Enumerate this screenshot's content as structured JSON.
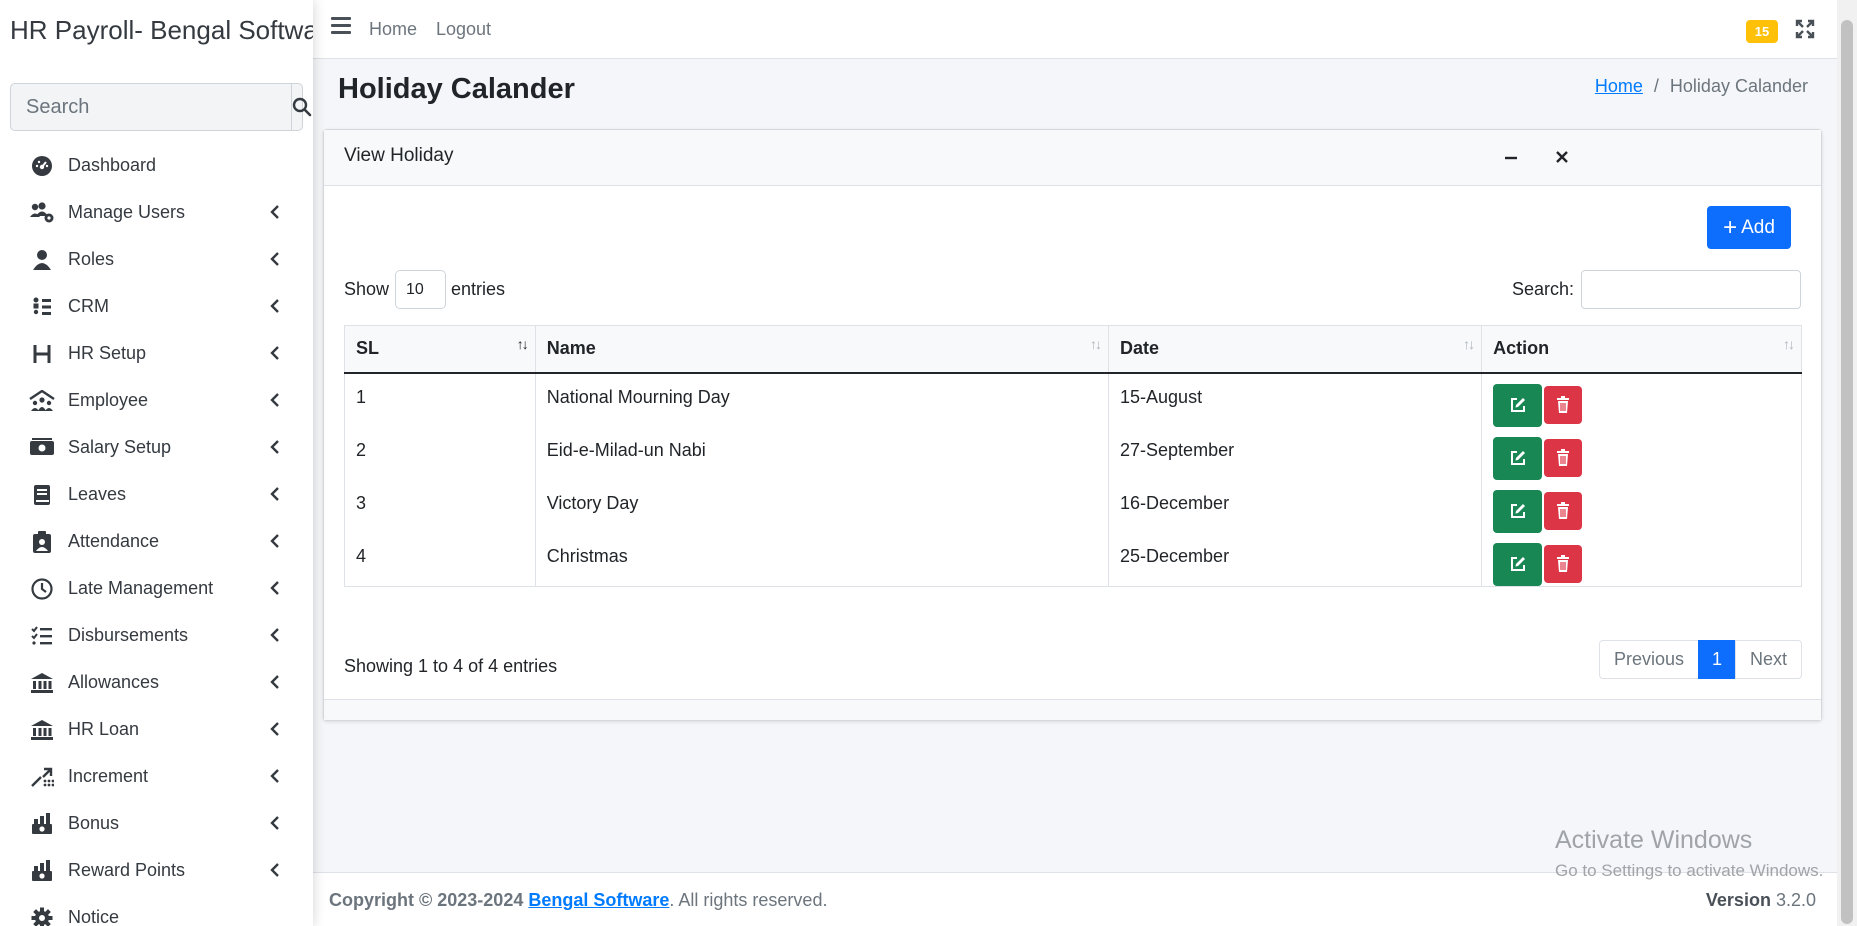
{
  "app": {
    "brand": "HR Payroll- Bengal Software"
  },
  "sidebar": {
    "search_placeholder": "Search",
    "items": [
      {
        "label": "Dashboard",
        "icon": "dashboard-icon",
        "has_children": false
      },
      {
        "label": "Manage Users",
        "icon": "users-cog-icon",
        "has_children": true
      },
      {
        "label": "Roles",
        "icon": "user-icon",
        "has_children": true
      },
      {
        "label": "CRM",
        "icon": "crm-icon",
        "has_children": true
      },
      {
        "label": "HR Setup",
        "icon": "h-icon",
        "has_children": true
      },
      {
        "label": "Employee",
        "icon": "people-roof-icon",
        "has_children": true
      },
      {
        "label": "Salary Setup",
        "icon": "money-icon",
        "has_children": true
      },
      {
        "label": "Leaves",
        "icon": "book-icon",
        "has_children": true
      },
      {
        "label": "Attendance",
        "icon": "clipboard-user-icon",
        "has_children": true
      },
      {
        "label": "Late Management",
        "icon": "clock-icon",
        "has_children": true
      },
      {
        "label": "Disbursements",
        "icon": "list-check-icon",
        "has_children": true
      },
      {
        "label": "Allowances",
        "icon": "bank-icon",
        "has_children": true
      },
      {
        "label": "HR Loan",
        "icon": "bank-icon",
        "has_children": true
      },
      {
        "label": "Increment",
        "icon": "chart-up-icon",
        "has_children": true
      },
      {
        "label": "Bonus",
        "icon": "gift-chart-icon",
        "has_children": true
      },
      {
        "label": "Reward Points",
        "icon": "reward-chart-icon",
        "has_children": true
      },
      {
        "label": "Notice",
        "icon": "gear-icon",
        "has_children": false
      }
    ]
  },
  "topnav": {
    "home": "Home",
    "logout": "Logout",
    "badge": "15"
  },
  "page": {
    "title": "Holiday Calander",
    "breadcrumb": {
      "home": "Home",
      "separator": "/",
      "current": "Holiday Calander"
    }
  },
  "card": {
    "title": "View Holiday",
    "add_label": "Add",
    "show_label": "Show",
    "show_value": "10",
    "entries_label": "entries",
    "search_label": "Search:",
    "columns": [
      "SL",
      "Name",
      "Date",
      "Action"
    ],
    "rows": [
      {
        "sl": "1",
        "name": "National Mourning Day",
        "date": "15-August"
      },
      {
        "sl": "2",
        "name": "Eid-e-Milad-un Nabi",
        "date": "27-September"
      },
      {
        "sl": "3",
        "name": "Victory Day",
        "date": "16-December"
      },
      {
        "sl": "4",
        "name": "Christmas",
        "date": "25-December"
      }
    ],
    "info": "Showing 1 to 4 of 4 entries",
    "pagination": {
      "previous": "Previous",
      "current": "1",
      "next": "Next"
    }
  },
  "footer": {
    "copyright_prefix": "Copyright © 2023-2024",
    "company": "Bengal Software",
    "rights": ". All rights reserved.",
    "version_label": "Version",
    "version": "3.2.0"
  },
  "watermark": {
    "line1": "Activate Windows",
    "line2": "Go to Settings to activate Windows."
  },
  "colors": {
    "primary": "#0d6efd",
    "success": "#198754",
    "danger": "#dc3545",
    "warning": "#ffc107"
  }
}
